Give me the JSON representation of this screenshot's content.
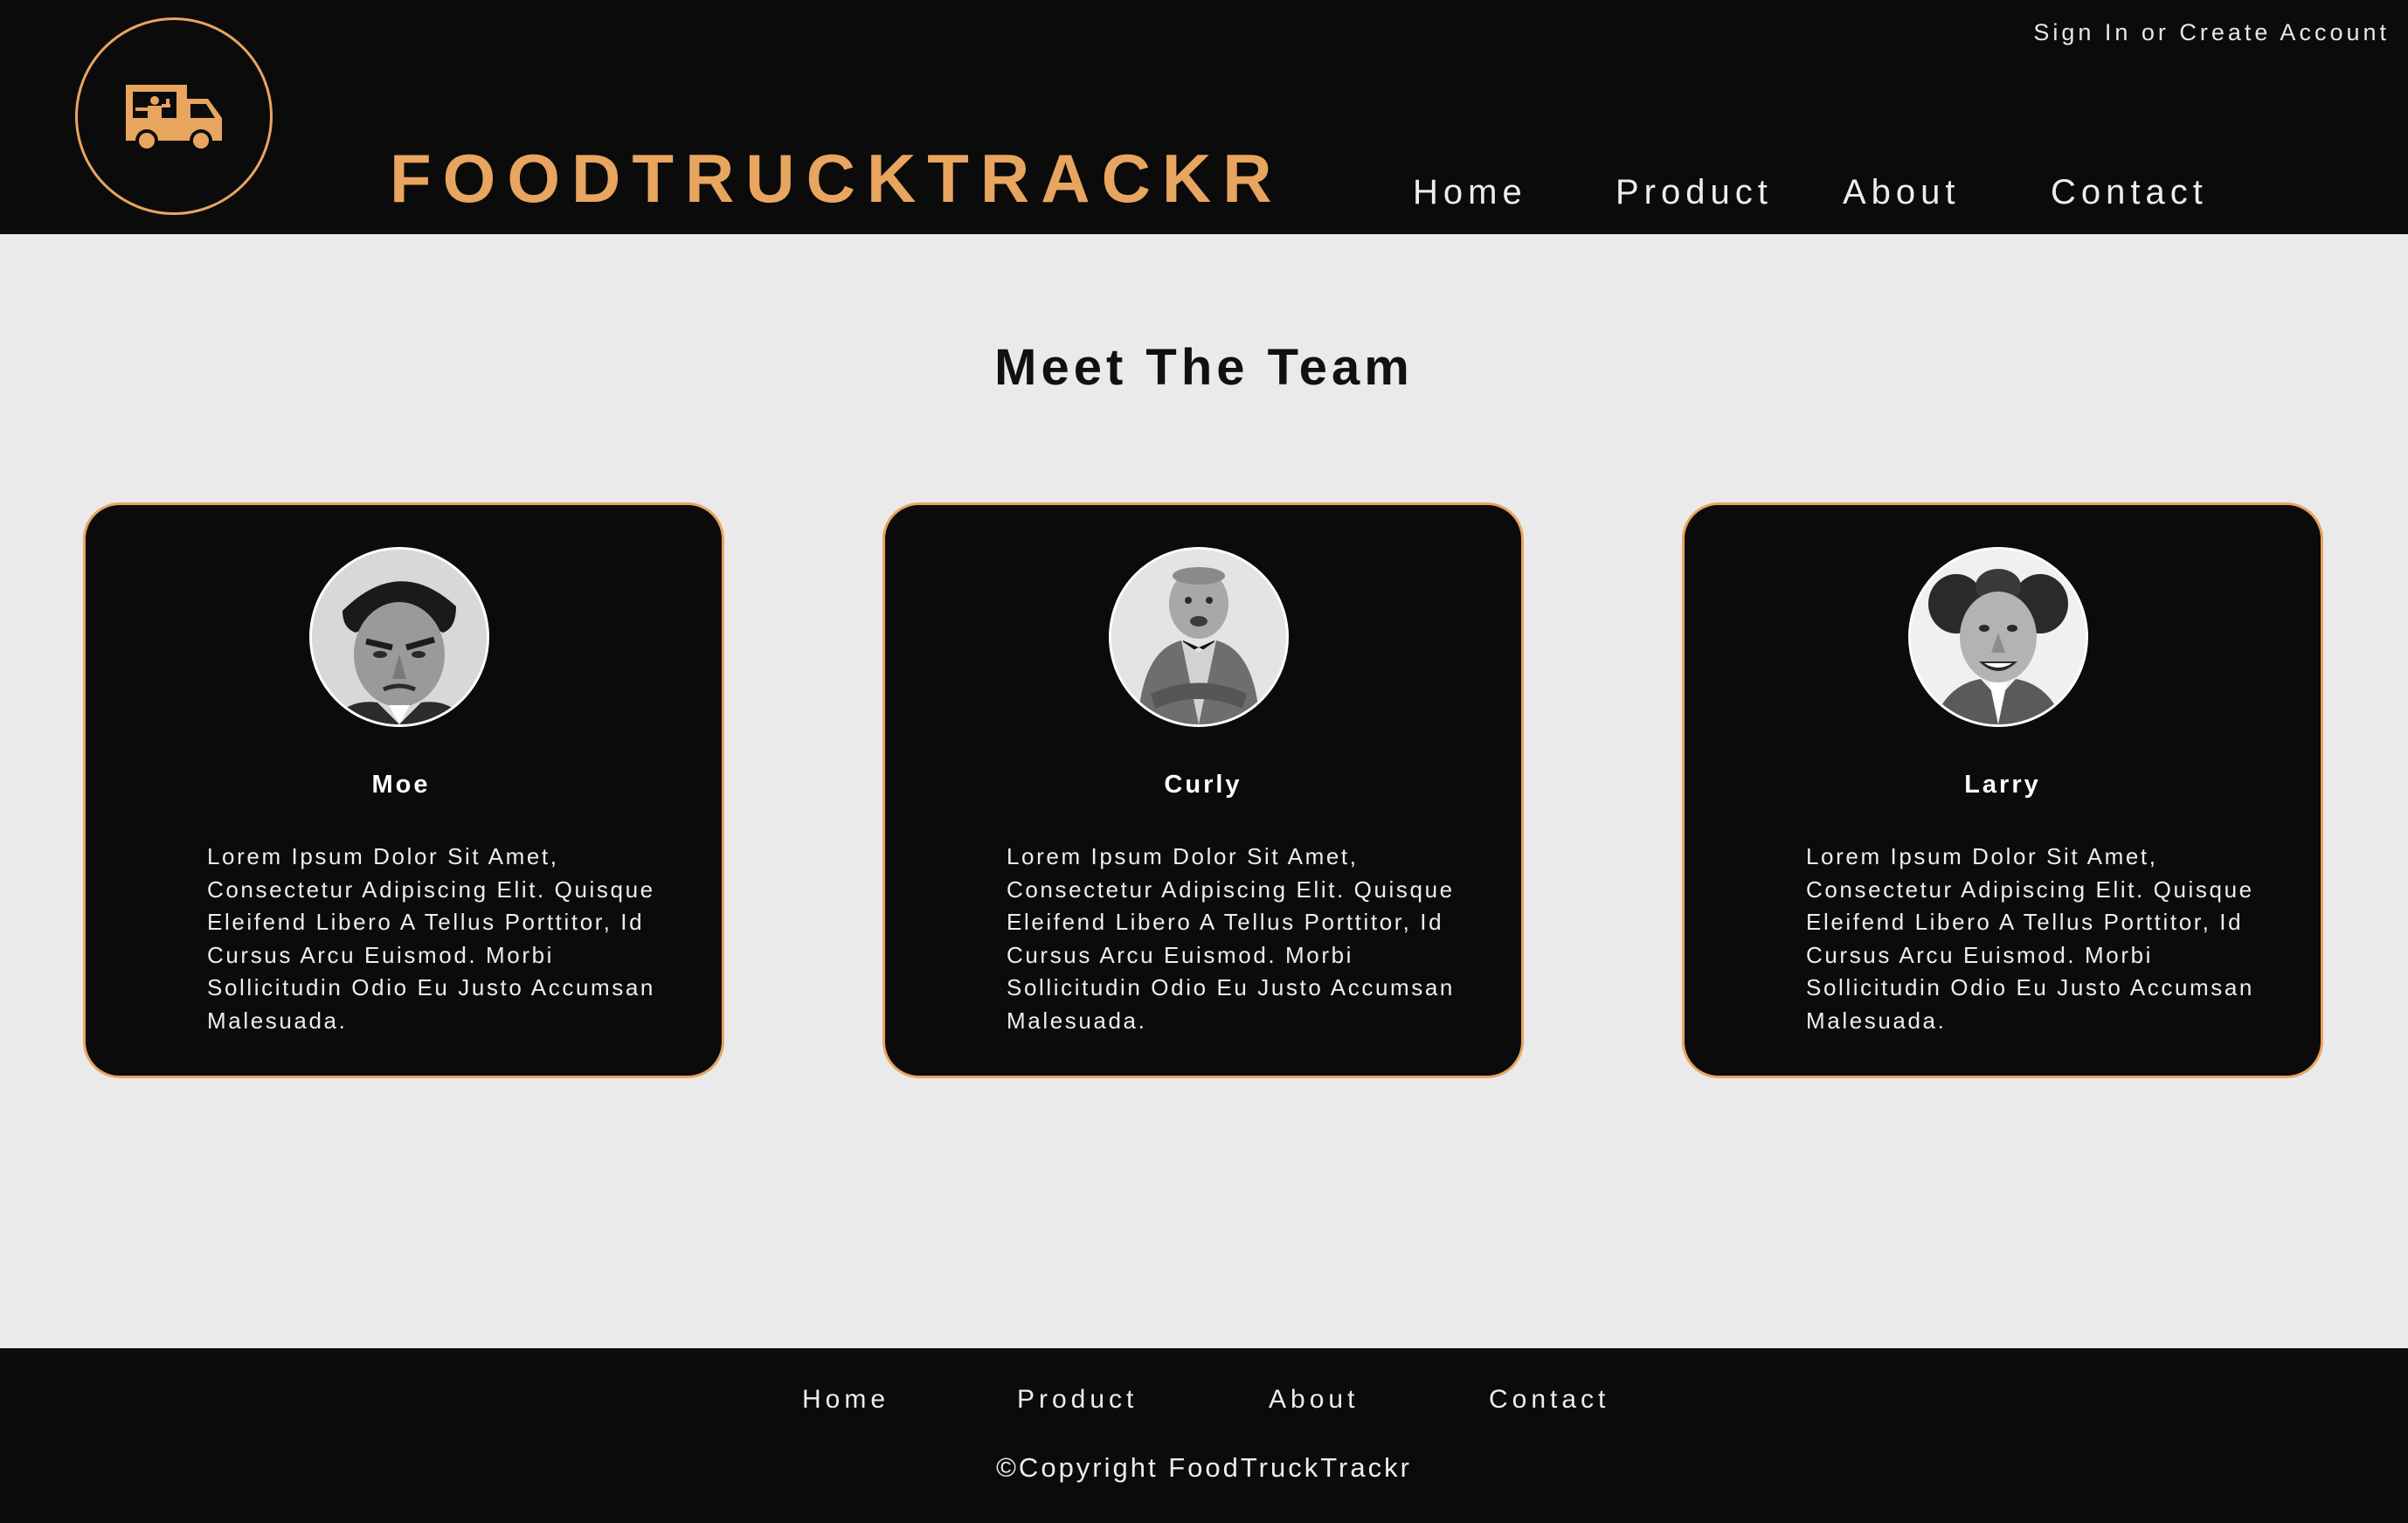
{
  "header": {
    "brand": "FOODTRUCKTRACKR",
    "logo_icon": "food-truck-icon",
    "signin": "Sign In or Create Account",
    "nav": [
      "Home",
      "Product",
      "About",
      "Contact"
    ]
  },
  "main": {
    "title": "Meet The Team",
    "team": [
      {
        "name": "Moe",
        "bio": "Lorem Ipsum Dolor Sit Amet, Consectetur Adipiscing Elit. Quisque Eleifend Libero A Tellus Porttitor, Id Cursus Arcu Euismod. Morbi Sollicitudin Odio Eu Justo Accumsan Malesuada."
      },
      {
        "name": "Curly",
        "bio": "Lorem Ipsum Dolor Sit Amet, Consectetur Adipiscing Elit. Quisque Eleifend Libero A Tellus Porttitor, Id Cursus Arcu Euismod. Morbi Sollicitudin Odio Eu Justo Accumsan Malesuada."
      },
      {
        "name": "Larry",
        "bio": "Lorem Ipsum Dolor Sit Amet, Consectetur Adipiscing Elit. Quisque Eleifend Libero A Tellus Porttitor, Id Cursus Arcu Euismod. Morbi Sollicitudin Odio Eu Justo Accumsan Malesuada."
      }
    ]
  },
  "footer": {
    "nav": [
      "Home",
      "Product",
      "About",
      "Contact"
    ],
    "copyright": "©Copyright FoodTruckTrackr"
  },
  "colors": {
    "accent": "#e8a55f",
    "dark": "#0b0b0b",
    "page_background": "#eaeaea"
  }
}
